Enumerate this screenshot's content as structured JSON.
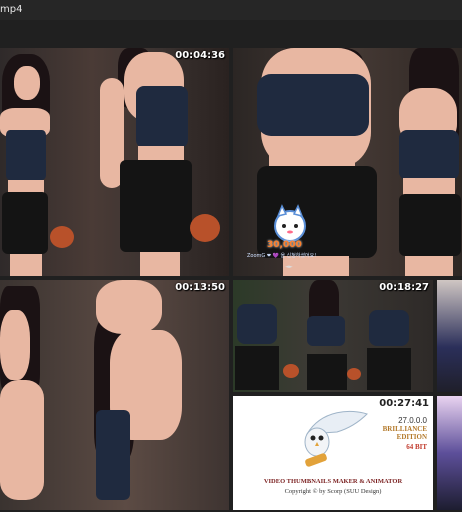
{
  "window": {
    "title_fragment": "mp4"
  },
  "thumbnails": [
    {
      "timestamp": "00:04:36"
    },
    {
      "timestamp": ""
    },
    {
      "timestamp": "00:13:50"
    },
    {
      "timestamp": "00:18:27"
    },
    {
      "timestamp": "00:27:41"
    }
  ],
  "overlay_badge": {
    "number": "30,000",
    "message": "ZoomG ❤ 💜 을 신청하셨어요!",
    "indicator": "◄►"
  },
  "product_card": {
    "version": "27.0.0.0",
    "edition_line1": "BRILLIANCE",
    "edition_line2": "EDITION",
    "bits": "64 BIT",
    "product_name": "VIDEO THUMBNAILS MAKER & ANIMATOR",
    "copyright": "Copyright © by Scorp (SUU Design)"
  },
  "colors": {
    "background": "#202020",
    "timestamp_text": "#ffffff",
    "product_name": "#7a1f1f",
    "edition": "#b3792a",
    "bits": "#c0392b"
  }
}
